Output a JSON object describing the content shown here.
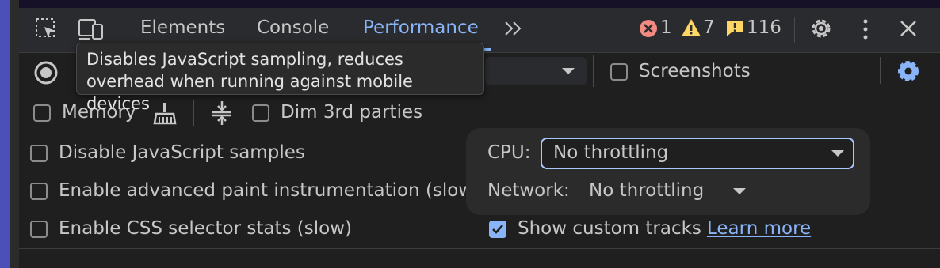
{
  "tabs": [
    {
      "label": "Elements"
    },
    {
      "label": "Console"
    },
    {
      "label": "Performance"
    }
  ],
  "status": {
    "errors": "1",
    "warnings": "7",
    "issues": "116"
  },
  "toolbar": {
    "screenshots_label": "Screenshots",
    "memory_label": "Memory",
    "dim_label": "Dim 3rd parties"
  },
  "tooltip": {
    "line1": "Disables JavaScript sampling, reduces",
    "line2": "overhead when running against mobile devices"
  },
  "settings": {
    "disable_js_samples": "Disable JavaScript samples",
    "advanced_paint": "Enable advanced paint instrumentation (slow)",
    "css_selector_stats": "Enable CSS selector stats (slow)",
    "show_custom_tracks": "Show custom tracks",
    "learn_more": "Learn more",
    "show_custom_tracks_checked": true
  },
  "throttling": {
    "cpu_label": "CPU:",
    "cpu_value": "No throttling",
    "network_label": "Network:",
    "network_value": "No throttling"
  },
  "colors": {
    "accent": "#8ab4f8",
    "error": "#f28b82",
    "warning": "#fdd663",
    "issue": "#fdd663"
  }
}
